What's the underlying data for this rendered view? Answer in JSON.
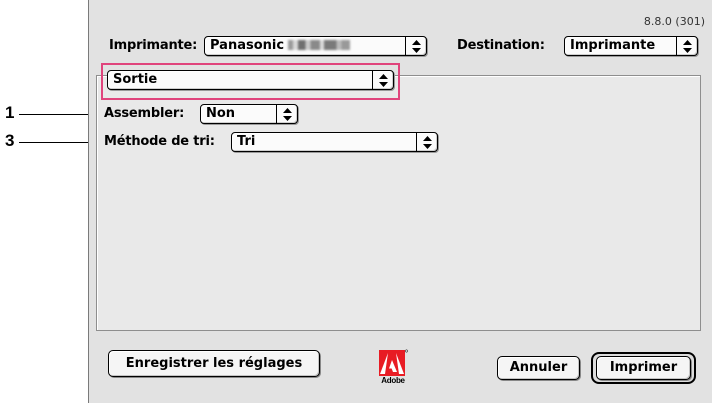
{
  "version": "8.8.0 (301)",
  "printer": {
    "label": "Imprimante:",
    "value": "Panasonic",
    "redacted_note": "blurred model name"
  },
  "destination": {
    "label": "Destination:",
    "value": "Imprimante"
  },
  "panel_selector": {
    "value": "Sortie"
  },
  "options": {
    "collate": {
      "label": "Assembler:",
      "value": "Non",
      "callout": "1"
    },
    "sort_method": {
      "label": "Méthode de tri:",
      "value": "Tri",
      "callout": "3"
    }
  },
  "buttons": {
    "save_settings": "Enregistrer les réglages",
    "cancel": "Annuler",
    "print": "Imprimer"
  },
  "logo": {
    "text": "Adobe"
  },
  "colors": {
    "highlight": "#e0447c",
    "dialog_bg": "#e2e2e2"
  }
}
